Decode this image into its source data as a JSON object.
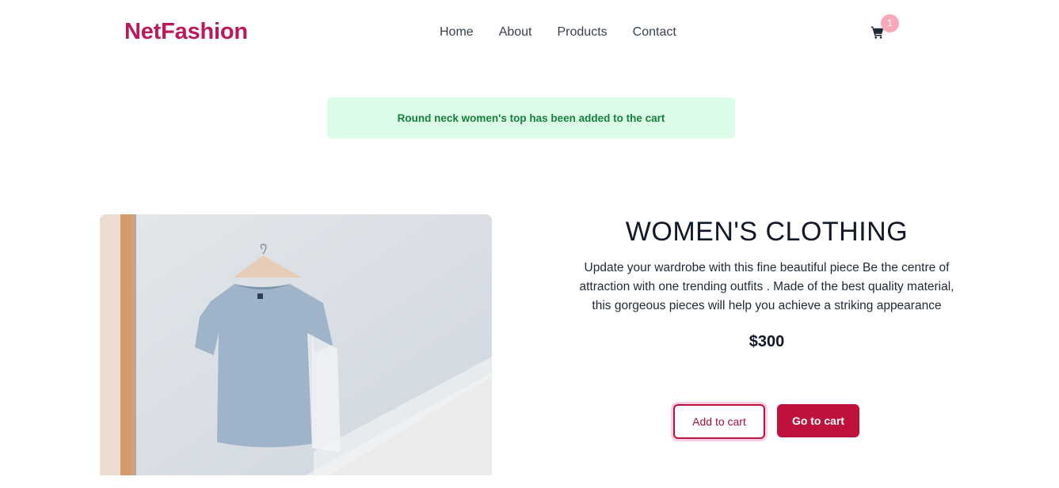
{
  "header": {
    "logo": "NetFashion",
    "nav": [
      "Home",
      "About",
      "Products",
      "Contact"
    ],
    "cart_count": "1",
    "cart_icon": "shopping-cart-icon"
  },
  "alert": {
    "message": "Round neck women's top has been added to the cart"
  },
  "product": {
    "image": "product-photo",
    "category": "WOMEN'S CLOTHING",
    "description": "Update your wardrobe with this fine beautiful piece Be the centre of attraction with one trending outfits . Made of the best quality material, this gorgeous pieces will help you achieve a striking appearance",
    "price": "$300",
    "add_to_cart_label": "Add to cart",
    "go_to_cart_label": "Go to cart"
  },
  "colors": {
    "brand": "#be185d",
    "alert_bg": "#dcfce7",
    "alert_text": "#15803d",
    "button": "#be123c"
  }
}
